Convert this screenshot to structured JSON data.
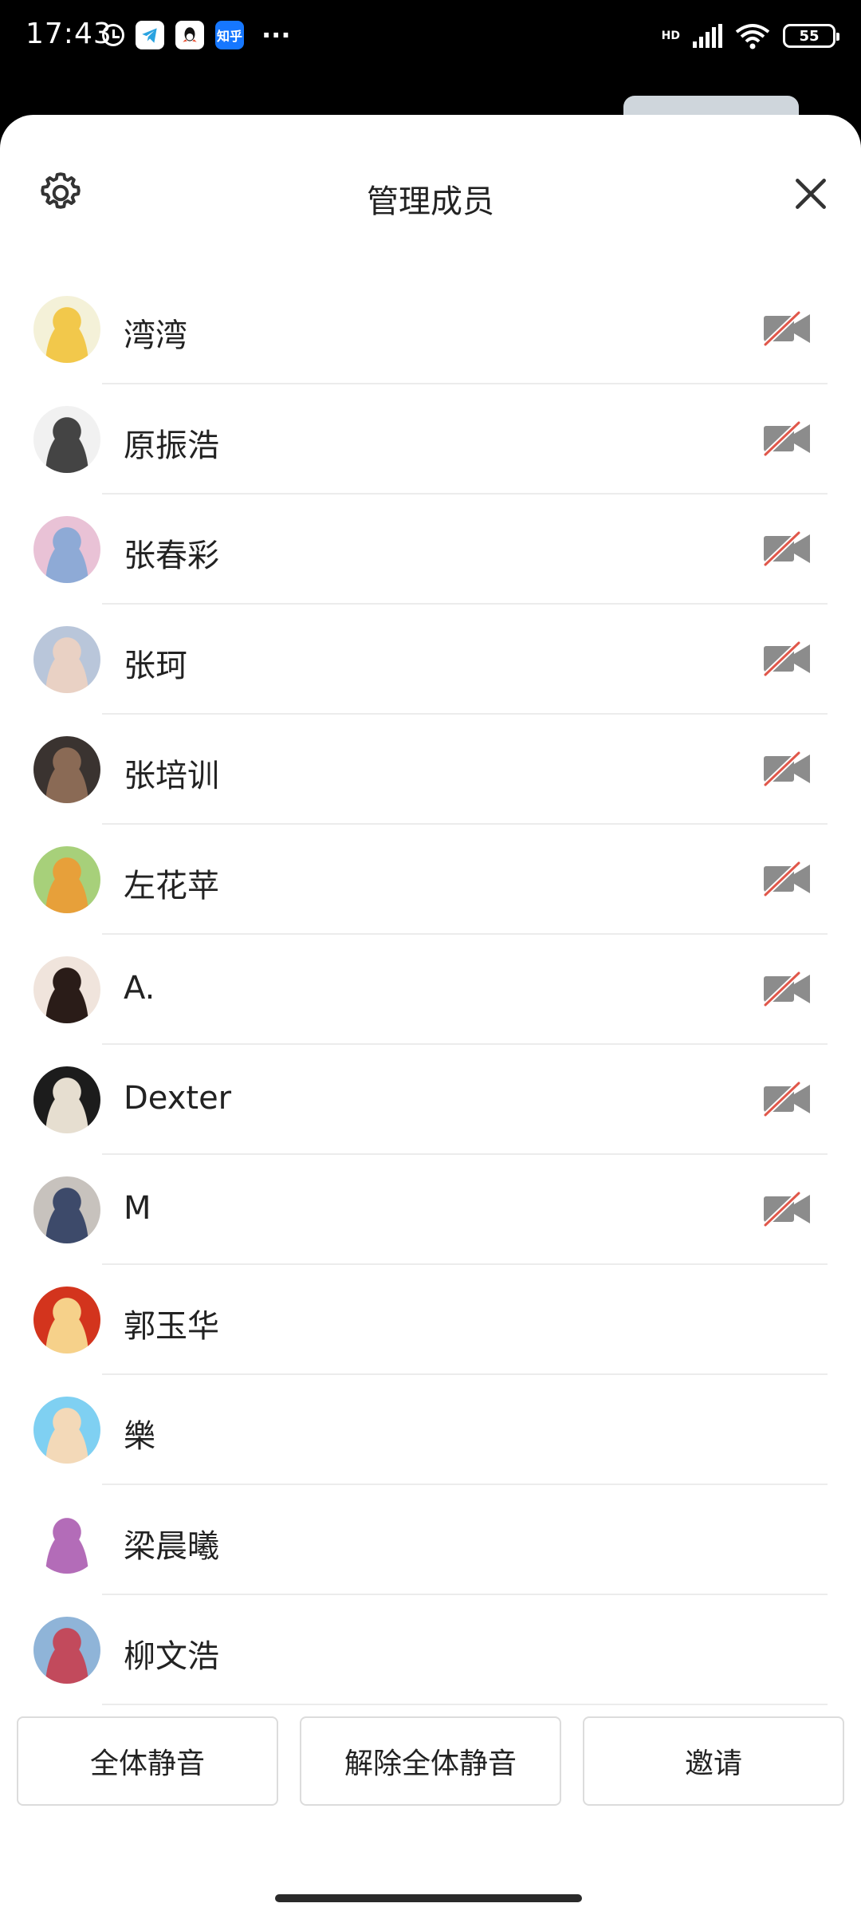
{
  "status_bar": {
    "time": "17:43",
    "network": "HD",
    "battery": "55",
    "zhihu_label": "知乎"
  },
  "header": {
    "title": "管理成员"
  },
  "members": [
    {
      "name": "湾湾",
      "camera_off": true,
      "avatar_colors": [
        "#f4f1d8",
        "#f2c84b"
      ]
    },
    {
      "name": "原振浩",
      "camera_off": true,
      "avatar_colors": [
        "#f1f1f1",
        "#444444"
      ]
    },
    {
      "name": "张春彩",
      "camera_off": true,
      "avatar_colors": [
        "#e9c2d6",
        "#8eaad6"
      ]
    },
    {
      "name": "张珂",
      "camera_off": true,
      "avatar_colors": [
        "#b9c6da",
        "#e9d1c4"
      ]
    },
    {
      "name": "张培训",
      "camera_off": true,
      "avatar_colors": [
        "#3a3330",
        "#8a6a55"
      ]
    },
    {
      "name": "左花苹",
      "camera_off": true,
      "avatar_colors": [
        "#a7d07a",
        "#e7a03a"
      ]
    },
    {
      "name": "A.",
      "camera_off": true,
      "avatar_colors": [
        "#f0e4dc",
        "#2a1c18"
      ]
    },
    {
      "name": "Dexter",
      "camera_off": true,
      "avatar_colors": [
        "#1c1c1c",
        "#e6ded0"
      ]
    },
    {
      "name": "M",
      "camera_off": true,
      "avatar_colors": [
        "#c7c2bd",
        "#3d4a6a"
      ]
    },
    {
      "name": "郭玉华",
      "camera_off": false,
      "avatar_colors": [
        "#d3341d",
        "#f6d18a"
      ]
    },
    {
      "name": "樂",
      "camera_off": false,
      "avatar_colors": [
        "#7fd0f2",
        "#f3d9b8"
      ]
    },
    {
      "name": "梁晨曦",
      "camera_off": false,
      "avatar_colors": [
        "#ffffff",
        "#b36cb8"
      ]
    },
    {
      "name": "柳文浩",
      "camera_off": false,
      "avatar_colors": [
        "#8fb4d8",
        "#c24a5c"
      ]
    }
  ],
  "actions": {
    "mute_all": "全体静音",
    "unmute_all": "解除全体静音",
    "invite": "邀请"
  },
  "icons": {
    "settings": "gear-icon",
    "close": "close-icon",
    "camera_off": "camera-off-icon"
  }
}
